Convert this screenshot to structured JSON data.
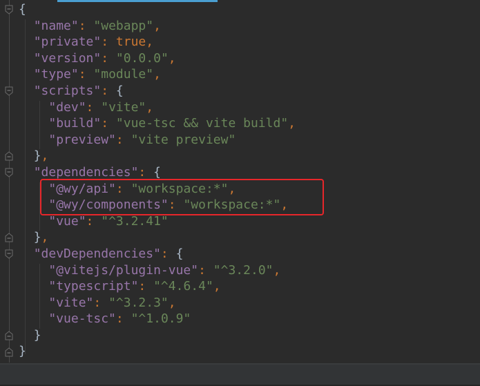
{
  "editor": {
    "file_content_lines": [
      [
        [
          "brace",
          "{"
        ]
      ],
      [
        [
          "ind",
          "  "
        ],
        [
          "key",
          "\"name\""
        ],
        [
          "colon",
          ": "
        ],
        [
          "str",
          "\"webapp\""
        ],
        [
          "punct",
          ","
        ]
      ],
      [
        [
          "ind",
          "  "
        ],
        [
          "key",
          "\"private\""
        ],
        [
          "colon",
          ": "
        ],
        [
          "kw",
          "true"
        ],
        [
          "punct",
          ","
        ]
      ],
      [
        [
          "ind",
          "  "
        ],
        [
          "key",
          "\"version\""
        ],
        [
          "colon",
          ": "
        ],
        [
          "str",
          "\"0.0.0\""
        ],
        [
          "punct",
          ","
        ]
      ],
      [
        [
          "ind",
          "  "
        ],
        [
          "key",
          "\"type\""
        ],
        [
          "colon",
          ": "
        ],
        [
          "str",
          "\"module\""
        ],
        [
          "punct",
          ","
        ]
      ],
      [
        [
          "ind",
          "  "
        ],
        [
          "key",
          "\"scripts\""
        ],
        [
          "colon",
          ": "
        ],
        [
          "brace",
          "{"
        ]
      ],
      [
        [
          "ind",
          "    "
        ],
        [
          "key",
          "\"dev\""
        ],
        [
          "colon",
          ": "
        ],
        [
          "str",
          "\"vite\""
        ],
        [
          "punct",
          ","
        ]
      ],
      [
        [
          "ind",
          "    "
        ],
        [
          "key",
          "\"build\""
        ],
        [
          "colon",
          ": "
        ],
        [
          "str",
          "\"vue-tsc && vite build\""
        ],
        [
          "punct",
          ","
        ]
      ],
      [
        [
          "ind",
          "    "
        ],
        [
          "key",
          "\"preview\""
        ],
        [
          "colon",
          ": "
        ],
        [
          "str",
          "\"vite preview\""
        ]
      ],
      [
        [
          "ind",
          "  "
        ],
        [
          "brace",
          "}"
        ],
        [
          "punct",
          ","
        ]
      ],
      [
        [
          "ind",
          "  "
        ],
        [
          "key",
          "\"dependencies\""
        ],
        [
          "colon",
          ": "
        ],
        [
          "brace",
          "{"
        ]
      ],
      [
        [
          "ind",
          "    "
        ],
        [
          "key",
          "\"@wy/api\""
        ],
        [
          "colon",
          ": "
        ],
        [
          "str",
          "\"workspace:*\""
        ],
        [
          "punct",
          ","
        ]
      ],
      [
        [
          "ind",
          "    "
        ],
        [
          "key",
          "\"@wy/components\""
        ],
        [
          "colon",
          ": "
        ],
        [
          "str",
          "\"workspace:*\""
        ],
        [
          "punct",
          ","
        ]
      ],
      [
        [
          "ind",
          "    "
        ],
        [
          "key",
          "\"vue\""
        ],
        [
          "colon",
          ": "
        ],
        [
          "str",
          "\"^3.2.41\""
        ]
      ],
      [
        [
          "ind",
          "  "
        ],
        [
          "brace",
          "}"
        ],
        [
          "punct",
          ","
        ]
      ],
      [
        [
          "ind",
          "  "
        ],
        [
          "key",
          "\"devDependencies\""
        ],
        [
          "colon",
          ": "
        ],
        [
          "brace",
          "{"
        ]
      ],
      [
        [
          "ind",
          "    "
        ],
        [
          "key",
          "\"@vitejs/plugin-vue\""
        ],
        [
          "colon",
          ": "
        ],
        [
          "str",
          "\"^3.2.0\""
        ],
        [
          "punct",
          ","
        ]
      ],
      [
        [
          "ind",
          "    "
        ],
        [
          "key",
          "\"typescript\""
        ],
        [
          "colon",
          ": "
        ],
        [
          "str",
          "\"^4.6.4\""
        ],
        [
          "punct",
          ","
        ]
      ],
      [
        [
          "ind",
          "    "
        ],
        [
          "key",
          "\"vite\""
        ],
        [
          "colon",
          ": "
        ],
        [
          "str",
          "\"^3.2.3\""
        ],
        [
          "punct",
          ","
        ]
      ],
      [
        [
          "ind",
          "    "
        ],
        [
          "key",
          "\"vue-tsc\""
        ],
        [
          "colon",
          ": "
        ],
        [
          "str",
          "\"^1.0.9\""
        ]
      ],
      [
        [
          "ind",
          "  "
        ],
        [
          "brace",
          "}"
        ]
      ],
      [
        [
          "brace",
          "}"
        ]
      ]
    ],
    "fold_open_lines": [
      0,
      5,
      10,
      15
    ],
    "fold_close_lines": [
      9,
      14,
      20,
      21
    ],
    "highlight_color": "#e8262a"
  }
}
